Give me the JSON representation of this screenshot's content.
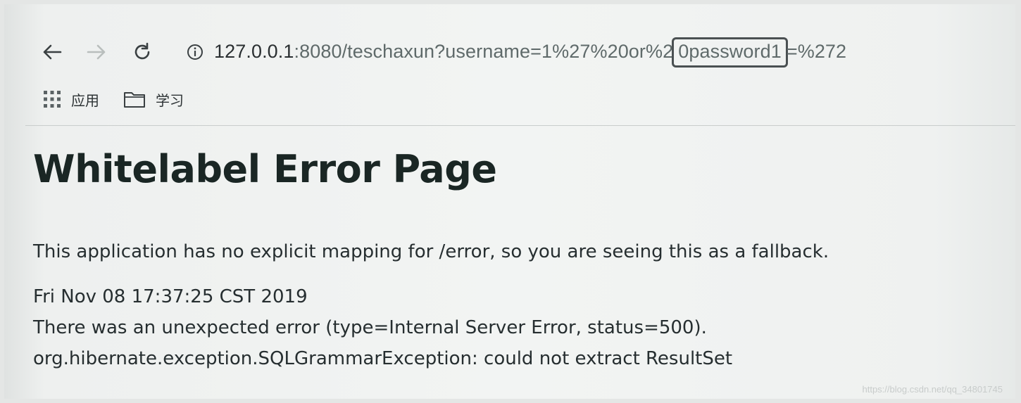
{
  "browser": {
    "url_host": "127.0.0.1",
    "url_before_highlight": ":8080/teschaxun?username=1%27%20or%2",
    "url_highlight": "0password1",
    "url_after_highlight": "=%272",
    "bookmarks": [
      {
        "label": "应用",
        "icon": "apps-grid-icon"
      },
      {
        "label": "学习",
        "icon": "folder-icon"
      }
    ]
  },
  "page": {
    "title": "Whitelabel Error Page",
    "message": "This application has no explicit mapping for /error, so you are seeing this as a fallback.",
    "timestamp": "Fri Nov 08 17:37:25 CST 2019",
    "error_line": "There was an unexpected error (type=Internal Server Error, status=500).",
    "exception_line": "org.hibernate.exception.SQLGrammarException: could not extract ResultSet"
  },
  "watermark": "https://blog.csdn.net/qq_34801745",
  "colors": {
    "background": "#f2f4f3",
    "text": "#262e30",
    "url_muted": "#5f6a6a",
    "highlight_border": "#4a5052"
  }
}
